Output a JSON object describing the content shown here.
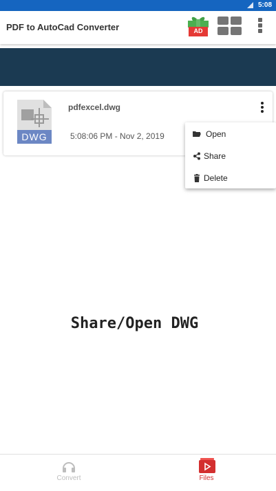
{
  "status": {
    "time": "5:08"
  },
  "appbar": {
    "title": "PDF to AutoCad Converter",
    "ad_label": "AD",
    "icons": [
      "gift-ad-icon",
      "grid-view-icon",
      "more-vert-icon"
    ]
  },
  "file": {
    "name": "pdfexcel.dwg",
    "date": "5:08:06 PM - Nov 2, 2019",
    "type_label": "DWG"
  },
  "menu": {
    "items": [
      {
        "label": "Open",
        "icon": "folder-open-icon"
      },
      {
        "label": "Share",
        "icon": "share-icon"
      },
      {
        "label": "Delete",
        "icon": "trash-icon"
      }
    ]
  },
  "center_caption": "Share/Open DWG",
  "bottom_nav": {
    "items": [
      {
        "label": "Convert",
        "icon": "convert-icon",
        "active": false
      },
      {
        "label": "Files",
        "icon": "files-icon",
        "active": true
      }
    ]
  },
  "colors": {
    "status_bar": "#1565c0",
    "banner": "#1b3a52",
    "accent_red": "#d32f2f",
    "inactive_gray": "#bdbdbd"
  }
}
